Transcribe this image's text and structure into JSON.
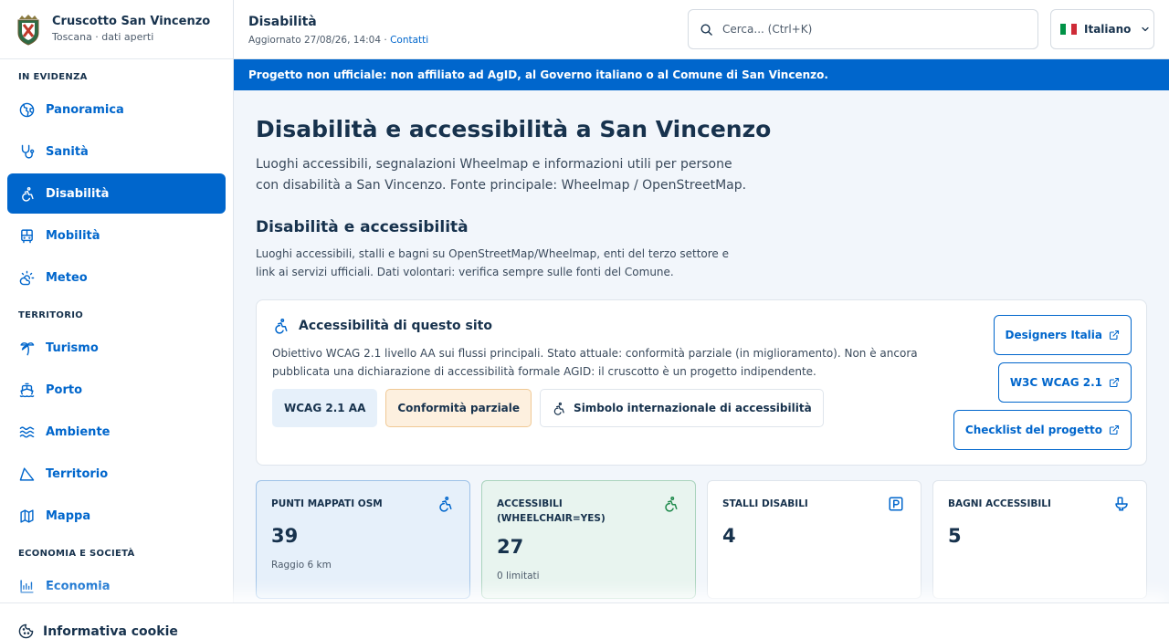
{
  "brand": {
    "name": "Cruscotto San Vincenzo",
    "subtitle": "Toscana · dati aperti"
  },
  "sidebar": {
    "sections": [
      {
        "label": "IN EVIDENZA",
        "items": [
          {
            "label": "Panoramica",
            "icon": "globe-icon"
          },
          {
            "label": "Sanità",
            "icon": "stethoscope-icon"
          },
          {
            "label": "Disabilità",
            "icon": "accessibility-icon",
            "active": true
          },
          {
            "label": "Mobilità",
            "icon": "bus-icon"
          },
          {
            "label": "Meteo",
            "icon": "sun-cloud-icon"
          }
        ]
      },
      {
        "label": "TERRITORIO",
        "items": [
          {
            "label": "Turismo",
            "icon": "palm-icon"
          },
          {
            "label": "Porto",
            "icon": "ship-icon"
          },
          {
            "label": "Ambiente",
            "icon": "waves-icon"
          },
          {
            "label": "Territorio",
            "icon": "mountain-icon"
          },
          {
            "label": "Mappa",
            "icon": "map-icon"
          }
        ]
      },
      {
        "label": "ECONOMIA E SOCIETÀ",
        "items": [
          {
            "label": "Economia",
            "icon": "chart-icon"
          }
        ]
      }
    ]
  },
  "header": {
    "title": "Disabilità",
    "updated": "Aggiornato 27/08/26, 14:04 · ",
    "contacts_link": "Contatti",
    "search_placeholder": "Cerca... (Ctrl+K)",
    "language": "Italiano"
  },
  "banner": "Progetto non ufficiale: non affiliato ad AgID, al Governo italiano o al Comune di San Vincenzo.",
  "main": {
    "title": "Disabilità e accessibilità a San Vincenzo",
    "lead": "Luoghi accessibili, segnalazioni Wheelmap e informazioni utili per persone con disabilità a San Vincenzo. Fonte principale: Wheelmap / OpenStreetMap.",
    "section_title": "Disabilità e accessibilità",
    "section_desc": "Luoghi accessibili, stalli e bagni su OpenStreetMap/Wheelmap, enti del terzo settore e link ai servizi ufficiali. Dati volontari: verifica sempre sulle fonti del Comune."
  },
  "a11y_card": {
    "title": "Accessibilità di questo sito",
    "body": "Obiettivo WCAG 2.1 livello AA sui flussi principali. Stato attuale: conformità parziale (in miglioramento). Non è ancora pubblicata una dichiarazione di accessibilità formale AGID: il cruscotto è un progetto indipendente.",
    "chips": [
      "WCAG 2.1 AA",
      "Conformità parziale",
      "Simbolo internazionale di accessibilità"
    ],
    "links": [
      "Designers Italia",
      "W3C WCAG 2.1",
      "Checklist del progetto"
    ]
  },
  "stats": [
    {
      "label": "PUNTI MAPPATI OSM",
      "value": "39",
      "note": "Raggio 6 km",
      "icon": "accessibility-icon",
      "tone": "blue"
    },
    {
      "label": "ACCESSIBILI (WHEELCHAIR=YES)",
      "value": "27",
      "note": "0 limitati",
      "icon": "accessibility-icon",
      "tone": "green"
    },
    {
      "label": "STALLI DISABILI",
      "value": "4",
      "note": "",
      "icon": "parking-icon",
      "tone": "white"
    },
    {
      "label": "BAGNI ACCESSIBILI",
      "value": "5",
      "note": "",
      "icon": "toilet-icon",
      "tone": "white"
    }
  ],
  "cookie": {
    "title": "Informativa cookie"
  },
  "colors": {
    "primary": "#0066cc",
    "text": "#17324d",
    "background": "#f2f6fb",
    "green_icon": "#1f8a4c"
  }
}
